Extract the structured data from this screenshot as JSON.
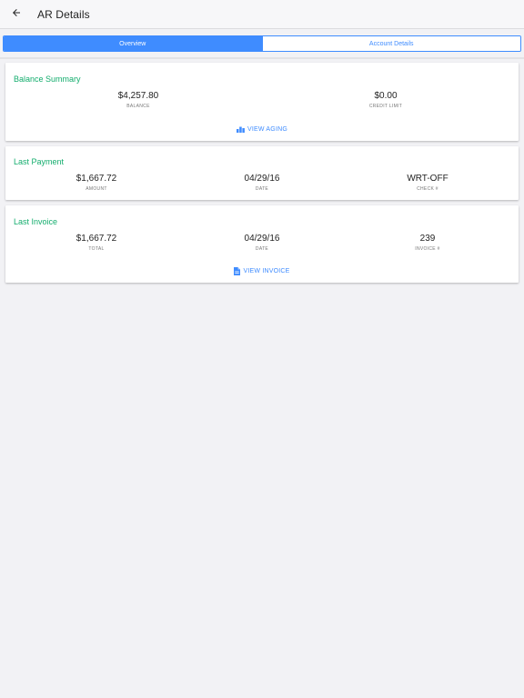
{
  "header": {
    "title": "AR Details",
    "back_icon": "arrow-left-icon"
  },
  "tabs": [
    {
      "label": "Overview",
      "active": true
    },
    {
      "label": "Account Details",
      "active": false
    }
  ],
  "colors": {
    "accent": "#3f8cff",
    "section_title": "#13ad6d"
  },
  "balance_summary": {
    "title": "Balance Summary",
    "balance": {
      "value": "$4,257.80",
      "label": "BALANCE"
    },
    "credit_limit": {
      "value": "$0.00",
      "label": "CREDIT LIMIT"
    },
    "action": {
      "label": "VIEW AGING",
      "icon": "bar-chart-icon"
    }
  },
  "last_payment": {
    "title": "Last Payment",
    "amount": {
      "value": "$1,667.72",
      "label": "AMOUNT"
    },
    "date": {
      "value": "04/29/16",
      "label": "DATE"
    },
    "check": {
      "value": "WRT-OFF",
      "label": "CHECK #"
    }
  },
  "last_invoice": {
    "title": "Last Invoice",
    "total": {
      "value": "$1,667.72",
      "label": "TOTAL"
    },
    "date": {
      "value": "04/29/16",
      "label": "DATE"
    },
    "invoice": {
      "value": "239",
      "label": "INVOICE #"
    },
    "action": {
      "label": "VIEW INVOICE",
      "icon": "document-icon"
    }
  }
}
